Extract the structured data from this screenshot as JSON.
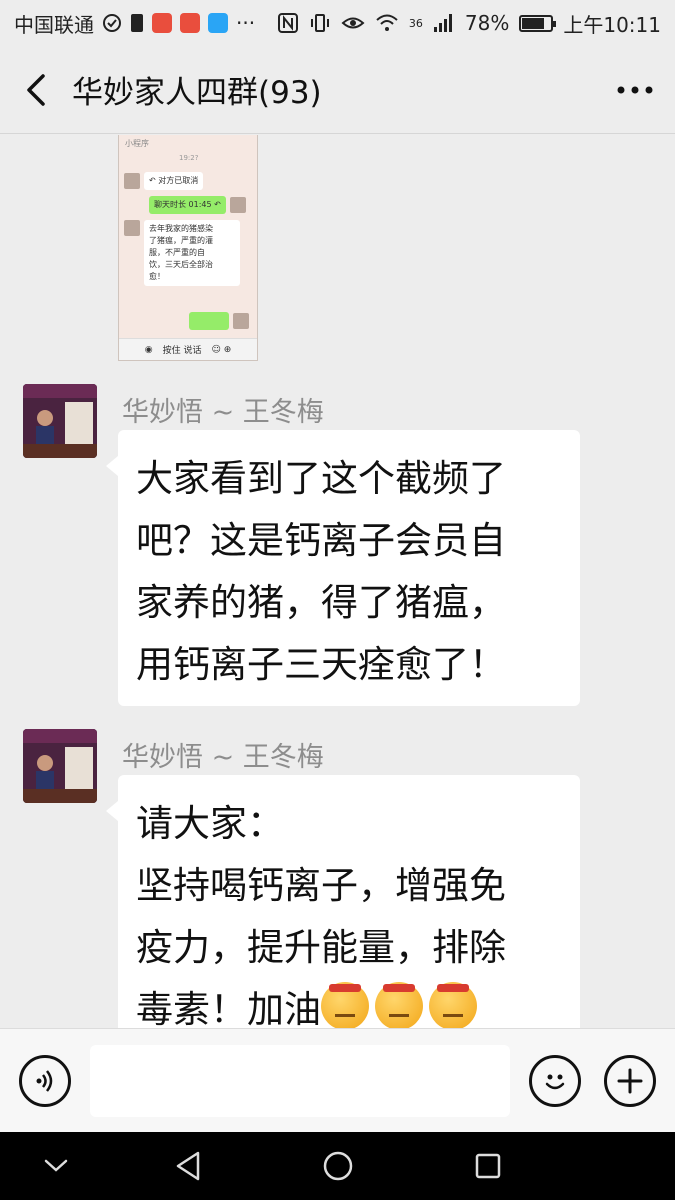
{
  "status_bar": {
    "carrier": "中国联通",
    "network": "36",
    "battery": "78%",
    "battery_level": 0.78,
    "time": "上午10:11"
  },
  "title_bar": {
    "title": "华妙家人四群(93)",
    "back_icon": "chevron-left-icon",
    "more_icon": "more-dots-icon"
  },
  "screenshot_message": {
    "top_label": "小程序",
    "time": "19:2?",
    "cancel_text": "对方已取消",
    "call_duration": "聊天时长 01:45",
    "text_lines": [
      "去年我家的猪感染",
      "了猪瘟，严重的灌",
      "服，不严重的自",
      "饮，三天后全部治",
      "愈！"
    ],
    "bottom_hold": "按住 说话"
  },
  "messages": [
    {
      "sender": "华妙悟 ~ 王冬梅",
      "lines": [
        "大家看到了这个截频了",
        "吧？这是钙离子会员自",
        "家养的猪，得了猪瘟，",
        "用钙离子三天痊愈了！"
      ]
    },
    {
      "sender": "华妙悟 ~ 王冬梅",
      "lines": [
        "请大家：",
        "坚持喝钙离子，增强免",
        "疫力，提升能量，排除",
        "毒素！加油"
      ],
      "emojis": [
        "angry-face-emoji",
        "angry-face-emoji",
        "angry-face-emoji"
      ]
    }
  ],
  "input_bar": {
    "voice_icon": "voice-icon",
    "emoji_icon": "smiley-icon",
    "plus_icon": "plus-icon",
    "input_value": ""
  },
  "nav_bar": {
    "icons": [
      "hide-keyboard-icon",
      "back-triangle-icon",
      "home-circle-icon",
      "recents-square-icon"
    ]
  },
  "colors": {
    "background": "#ededed",
    "bubble": "#ffffff",
    "sender_text": "#8d8d8d",
    "green_bubble": "#95ec69"
  }
}
